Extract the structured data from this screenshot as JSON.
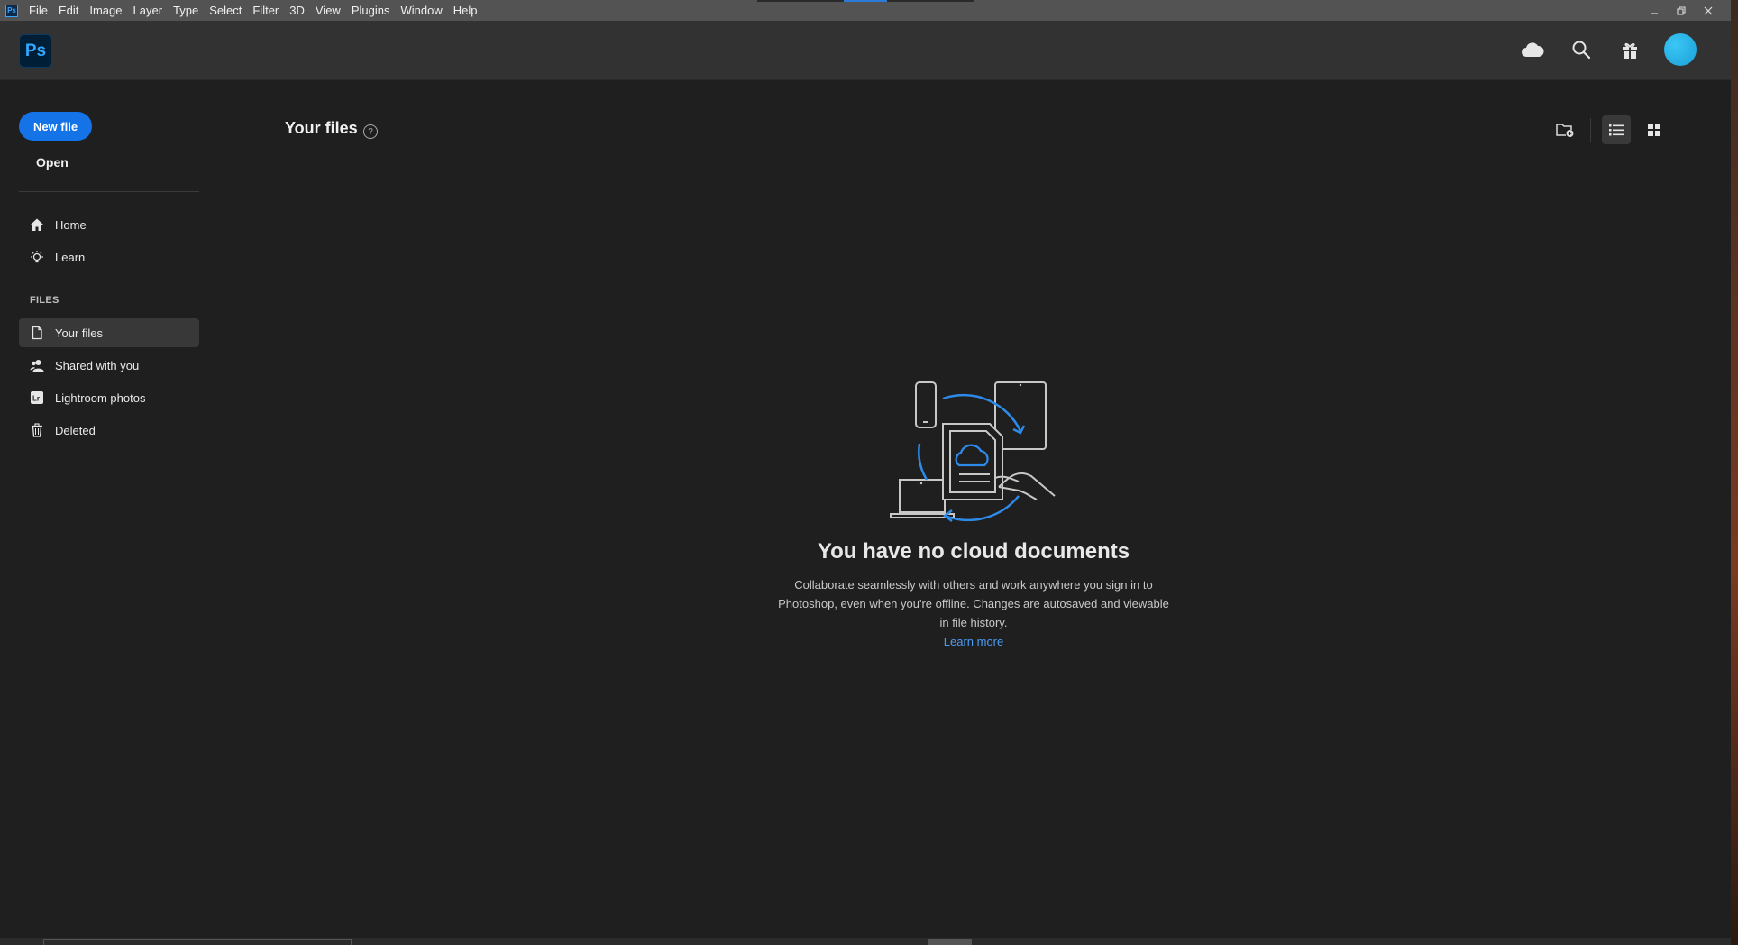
{
  "menubar": {
    "app_badge": "Ps",
    "items": [
      "File",
      "Edit",
      "Image",
      "Layer",
      "Type",
      "Select",
      "Filter",
      "3D",
      "View",
      "Plugins",
      "Window",
      "Help"
    ]
  },
  "header": {
    "logo": "Ps",
    "icons": [
      "cloud-icon",
      "search-icon",
      "gift-icon",
      "avatar"
    ]
  },
  "sidebar": {
    "new_file": "New file",
    "open": "Open",
    "nav": [
      {
        "label": "Home",
        "icon": "home-icon"
      },
      {
        "label": "Learn",
        "icon": "lightbulb-icon"
      }
    ],
    "files_section": "FILES",
    "files": [
      {
        "label": "Your files",
        "icon": "file-icon",
        "selected": true
      },
      {
        "label": "Shared with you",
        "icon": "shared-users-icon"
      },
      {
        "label": "Lightroom photos",
        "icon": "lightroom-icon"
      },
      {
        "label": "Deleted",
        "icon": "trash-icon"
      }
    ]
  },
  "main": {
    "title": "Your files",
    "help": "?",
    "empty_title": "You have no cloud documents",
    "empty_desc": "Collaborate seamlessly with others and work anywhere you sign in to Photoshop, even when you're offline. Changes are autosaved and viewable in file history.",
    "learn_more": "Learn more"
  },
  "colors": {
    "accent": "#1473e6",
    "link": "#4b9cf5",
    "background": "#1f1f1f",
    "header": "#323232",
    "menubar": "#535353"
  }
}
